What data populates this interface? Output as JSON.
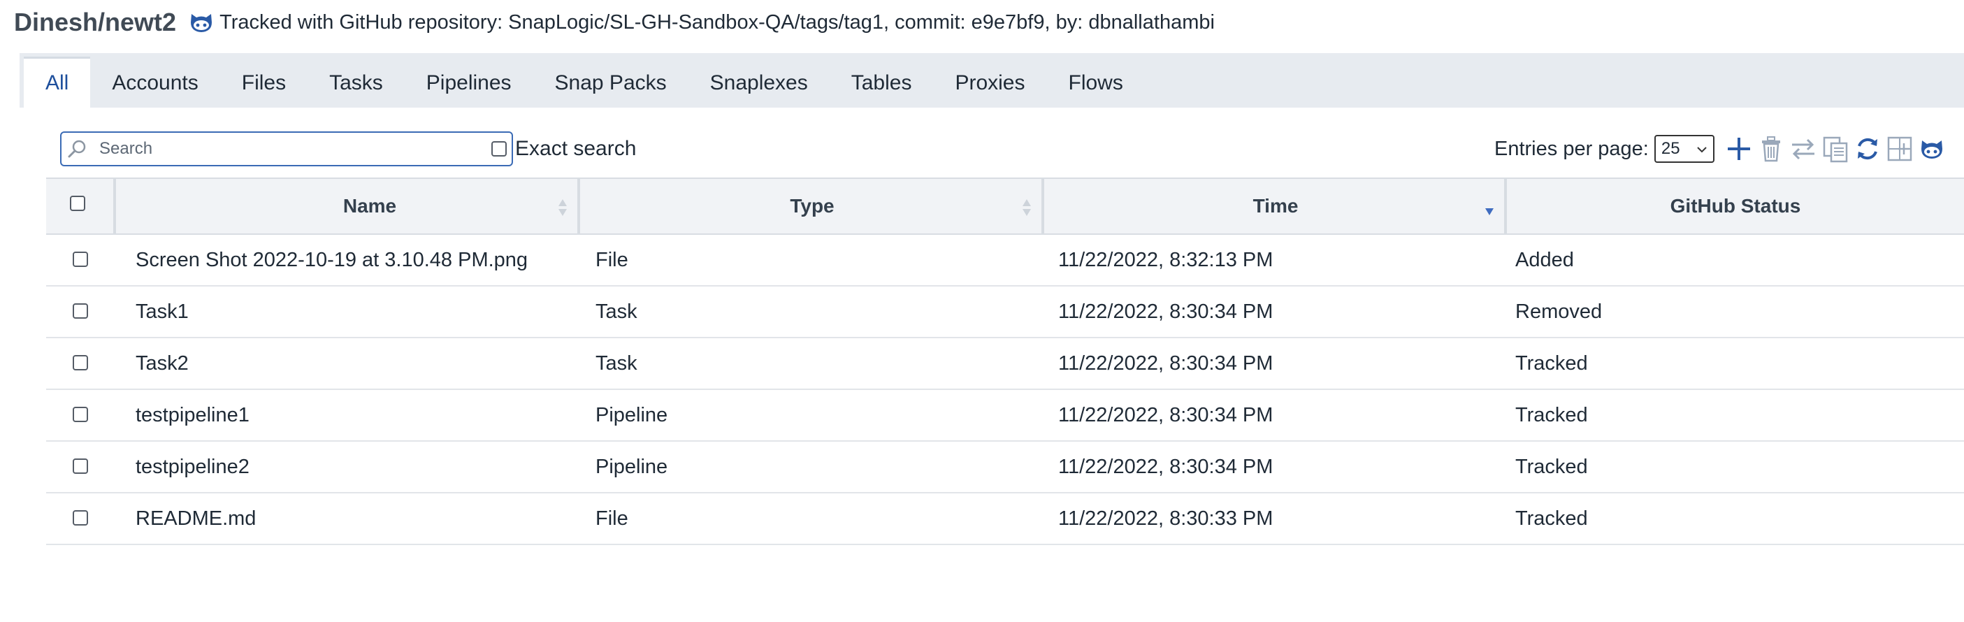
{
  "header": {
    "project": "Dinesh/newt2",
    "tracked_text": "Tracked with GitHub repository: SnapLogic/SL-GH-Sandbox-QA/tags/tag1, commit: e9e7bf9, by: dbnallathambi",
    "icon": "github-icon"
  },
  "tabs": [
    {
      "label": "All",
      "active": true
    },
    {
      "label": "Accounts",
      "active": false
    },
    {
      "label": "Files",
      "active": false
    },
    {
      "label": "Tasks",
      "active": false
    },
    {
      "label": "Pipelines",
      "active": false
    },
    {
      "label": "Snap Packs",
      "active": false
    },
    {
      "label": "Snaplexes",
      "active": false
    },
    {
      "label": "Tables",
      "active": false
    },
    {
      "label": "Proxies",
      "active": false
    },
    {
      "label": "Flows",
      "active": false
    }
  ],
  "toolbar": {
    "search_placeholder": "Search",
    "search_value": "",
    "exact_search_label": "Exact search",
    "exact_search_checked": false,
    "entries_label": "Entries per page:",
    "entries_value": "25",
    "icons": [
      "add-icon",
      "delete-icon",
      "move-icon",
      "copy-icon",
      "refresh-icon",
      "import-icon",
      "github-icon"
    ]
  },
  "colors": {
    "accent": "#1e4f9c",
    "tab_bar": "#e7ebf0",
    "icon_blue": "#2a5aa6"
  },
  "table": {
    "columns": [
      "Name",
      "Type",
      "Time",
      "GitHub Status"
    ],
    "sorted_by": "Time",
    "rows": [
      {
        "name": "Screen Shot 2022-10-19 at 3.10.48 PM.png",
        "type": "File",
        "time": "11/22/2022, 8:32:13 PM",
        "status": "Added"
      },
      {
        "name": "Task1",
        "type": "Task",
        "time": "11/22/2022, 8:30:34 PM",
        "status": "Removed"
      },
      {
        "name": "Task2",
        "type": "Task",
        "time": "11/22/2022, 8:30:34 PM",
        "status": "Tracked"
      },
      {
        "name": "testpipeline1",
        "type": "Pipeline",
        "time": "11/22/2022, 8:30:34 PM",
        "status": "Tracked"
      },
      {
        "name": "testpipeline2",
        "type": "Pipeline",
        "time": "11/22/2022, 8:30:34 PM",
        "status": "Tracked"
      },
      {
        "name": "README.md",
        "type": "File",
        "time": "11/22/2022, 8:30:33 PM",
        "status": "Tracked"
      }
    ]
  }
}
